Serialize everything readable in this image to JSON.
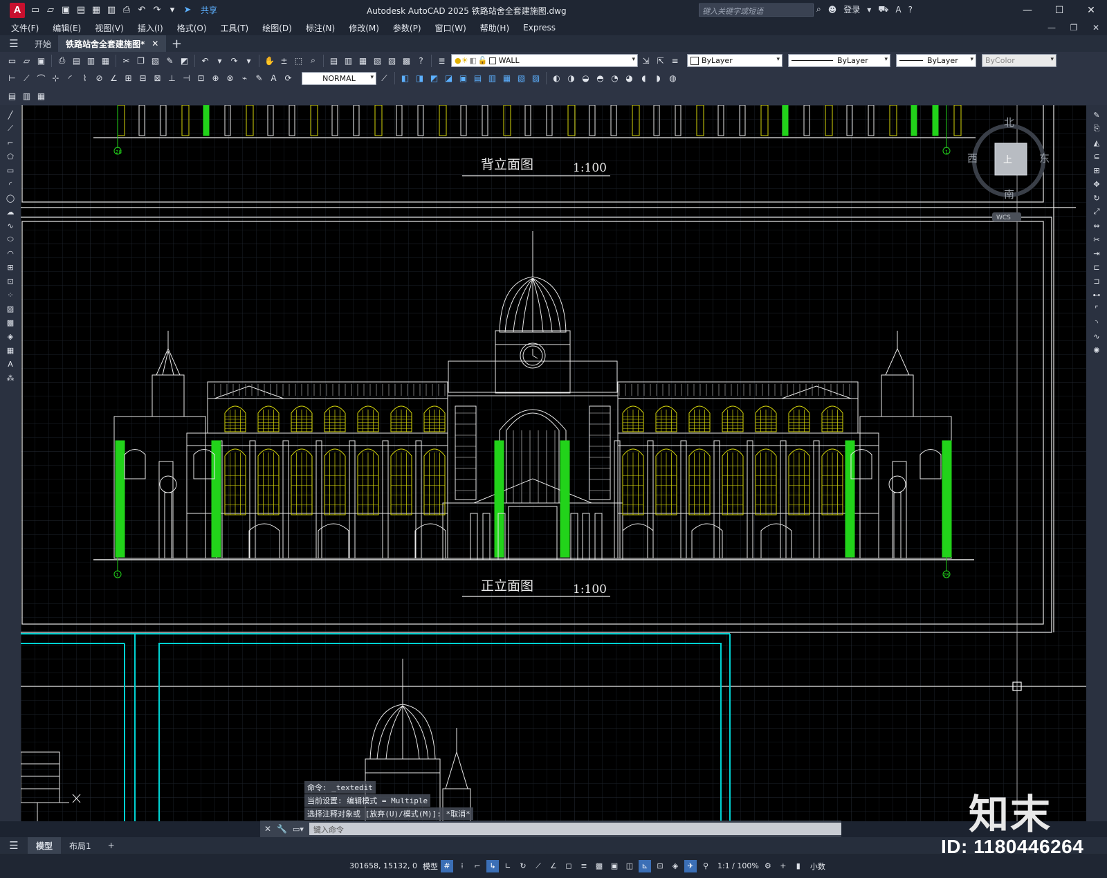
{
  "app": {
    "logo_letter": "A",
    "window_title": "Autodesk AutoCAD 2025    铁路站舍全套建施图.dwg",
    "share_label": "共享",
    "search_placeholder": "键入关键字或短语",
    "login_label": "登录"
  },
  "menu": [
    "文件(F)",
    "编辑(E)",
    "视图(V)",
    "插入(I)",
    "格式(O)",
    "工具(T)",
    "绘图(D)",
    "标注(N)",
    "修改(M)",
    "参数(P)",
    "窗口(W)",
    "帮助(H)",
    "Express"
  ],
  "tabs": {
    "start": "开始",
    "file": "铁路站舍全套建施图*",
    "close": "✕",
    "new": "+"
  },
  "toolbar": {
    "layer": "WALL",
    "color": "ByLayer",
    "linetype": "ByLayer",
    "lineweight": "ByLayer",
    "plotstyle": "ByColor",
    "dimstyle": "NORMAL"
  },
  "viewcube": {
    "north": "北",
    "south": "南",
    "east": "东",
    "west": "西",
    "top": "上",
    "wcs": "WCS"
  },
  "drawing": {
    "rear_title": "背立面图",
    "front_title": "正立面图",
    "scale": "1:100",
    "axis_start": "1",
    "axis_end": "28"
  },
  "command": {
    "history": [
      "命令: _textedit",
      "当前设置: 编辑模式 = Multiple",
      "选择注释对象或 [放弃(U)/模式(M)]: *取消*"
    ],
    "placeholder": "键入命令"
  },
  "layouts": {
    "model": "模型",
    "layout1": "布局1",
    "add": "+"
  },
  "status": {
    "coords": "301658, 15132, 0",
    "model": "模型",
    "scale": "1:1 / 100%",
    "units": "小数"
  },
  "watermark": {
    "brand": "知末",
    "id": "ID: 1180446264"
  },
  "colors": {
    "green_column": "#22d31a",
    "yellow_window": "#d8d80a",
    "cyan_frame": "#00d2d2",
    "line_white": "#e8e8e8"
  }
}
